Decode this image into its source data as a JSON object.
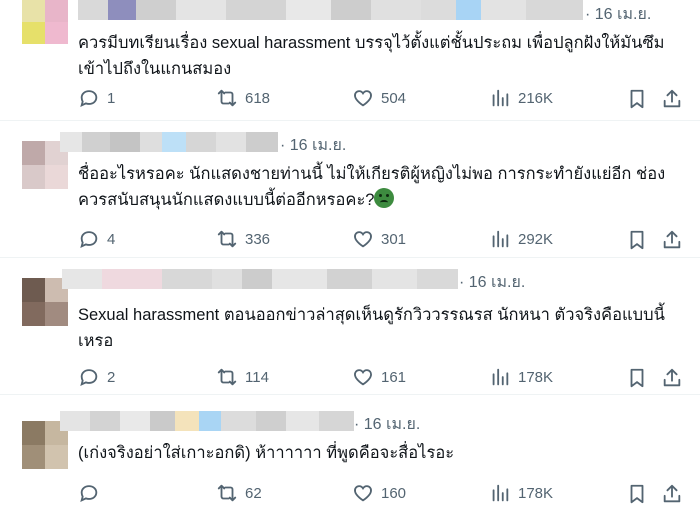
{
  "replies": [
    {
      "date": "16 เม.ย.",
      "text": "ควรมีบทเรียนเรื่อง sexual harassment บรรจุไว้ตั้งแต่ชั้นประถม เพื่อปลูกฝังให้มันซึมเข้าไปถึงในแกนสมอง",
      "stats": {
        "replies": "1",
        "retweets": "618",
        "likes": "504",
        "views": "216K"
      }
    },
    {
      "date": "16 เม.ย.",
      "text": "ชื่ออะไรหรอคะ นักแสดงชายท่านนี้ ไม่ให้เกียรติผู้หญิงไม่พอ การกระทำยังแย่อีก ช่องควรสนับสนุนนักแสดงแบบนี้ต่ออีกหรอคะ?",
      "emoji": "nauseated-face",
      "stats": {
        "replies": "4",
        "retweets": "336",
        "likes": "301",
        "views": "292K"
      }
    },
    {
      "date": "16 เม.ย.",
      "text": "Sexual harassment ตอนออกข่าวล่าสุดเห็นดูรักวิววรรณรส นักหนา ตัวจริงคือแบบนี้เหรอ",
      "stats": {
        "replies": "2",
        "retweets": "114",
        "likes": "161",
        "views": "178K"
      }
    },
    {
      "date": "16 เม.ย.",
      "text": "(เก่งจริงอย่าใส่เกาะอกดิ) ห้าาาาาา ที่พูดคือจะสื่อไรอะ",
      "stats": {
        "replies": "",
        "retweets": "62",
        "likes": "160",
        "views": "178K"
      }
    }
  ],
  "icons": {
    "reply": "reply-bubble-icon",
    "retweet": "retweet-arrows-icon",
    "like": "heart-icon",
    "views": "views-bars-icon",
    "bookmark": "bookmark-icon",
    "share": "share-upload-icon"
  },
  "colors": {
    "text": "#0f1419",
    "secondary": "#536471",
    "divider": "#eff3f4"
  }
}
